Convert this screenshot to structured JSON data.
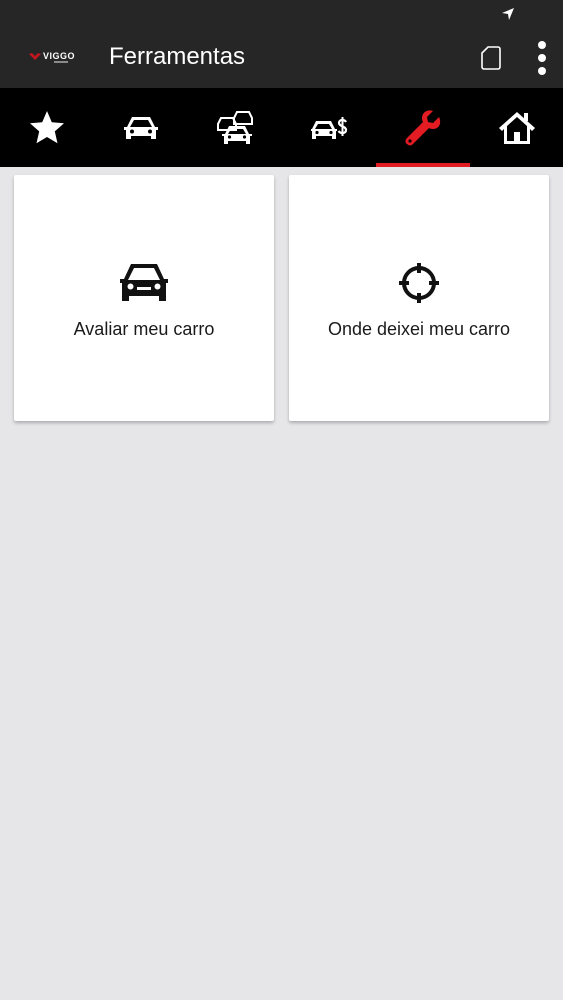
{
  "colors": {
    "app_bar": "#262626",
    "tab_bar": "#000000",
    "accent": "#e31b23",
    "background": "#e6e5e8",
    "card": "#ffffff"
  },
  "app_bar": {
    "logo_text": "VIGGO",
    "title": "Ferramentas",
    "actions": [
      "page-icon",
      "more-vertical-icon"
    ]
  },
  "tabs": [
    {
      "icon": "star-icon",
      "active": false
    },
    {
      "icon": "car-icon",
      "active": false
    },
    {
      "icon": "cars-icon",
      "active": false
    },
    {
      "icon": "car-dollar-icon",
      "active": false
    },
    {
      "icon": "wrench-icon",
      "active": true
    },
    {
      "icon": "home-icon",
      "active": false
    }
  ],
  "cards": [
    {
      "icon": "car-icon",
      "label": "Avaliar meu carro"
    },
    {
      "icon": "crosshair-icon",
      "label": "Onde deixei meu carro"
    }
  ]
}
